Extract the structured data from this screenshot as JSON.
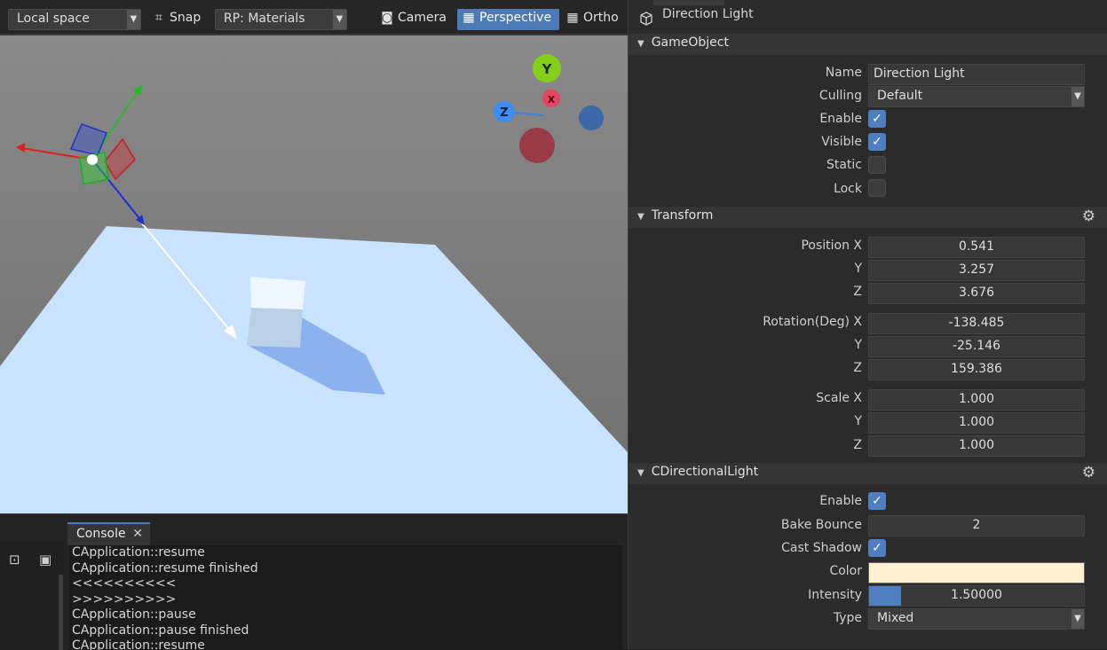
{
  "toolbar": {
    "space_select": "Local space",
    "snap_label": "Snap",
    "pipeline_select": "RP: Materials",
    "camera_label": "Camera",
    "perspective_label": "Perspective",
    "ortho_label": "Ortho"
  },
  "gizmo": {
    "y": "Y",
    "x": "X",
    "z": "Z"
  },
  "console": {
    "tab_label": "Console",
    "close_glyph": "✕",
    "lines": [
      "CApplication::resume",
      "CApplication::resume finished",
      "<<<<<<<<<<",
      ">>>>>>>>>>",
      "CApplication::pause",
      "CApplication::pause finished",
      "CApplication::resume"
    ]
  },
  "inspector": {
    "object_title": "Direction Light",
    "gameobject": {
      "header": "GameObject",
      "name_label": "Name",
      "name_value": "Direction Light",
      "culling_label": "Culling",
      "culling_value": "Default",
      "enable_label": "Enable",
      "enable_checked": true,
      "visible_label": "Visible",
      "visible_checked": true,
      "static_label": "Static",
      "static_checked": false,
      "lock_label": "Lock",
      "lock_checked": false
    },
    "transform": {
      "header": "Transform",
      "position_label": "Position X",
      "position_x": "0.541",
      "position_y": "3.257",
      "position_z": "3.676",
      "rotation_label": "Rotation(Deg) X",
      "rotation_x": "-138.485",
      "rotation_y": "-25.146",
      "rotation_z": "159.386",
      "scale_label": "Scale X",
      "scale_x": "1.000",
      "scale_y": "1.000",
      "scale_z": "1.000",
      "y_label": "Y",
      "z_label": "Z"
    },
    "light": {
      "header": "CDirectionalLight",
      "enable_label": "Enable",
      "enable_checked": true,
      "bake_bounce_label": "Bake Bounce",
      "bake_bounce_value": "2",
      "cast_shadow_label": "Cast Shadow",
      "cast_shadow_checked": true,
      "color_label": "Color",
      "color_value": "#fff0d2",
      "intensity_label": "Intensity",
      "intensity_value": "1.50000",
      "intensity_fraction": 0.15,
      "type_label": "Type",
      "type_value": "Mixed"
    }
  },
  "colors": {
    "accent": "#4d79b5",
    "panel": "#2b2b2b",
    "header": "#353535"
  }
}
